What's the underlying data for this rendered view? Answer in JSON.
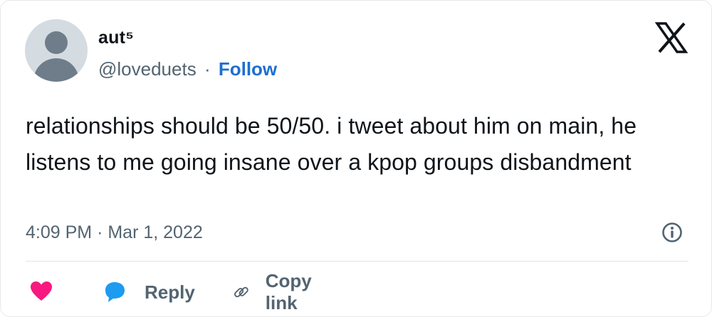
{
  "author": {
    "display_name": "aut⁵",
    "handle": "@loveduets",
    "separator": "·",
    "follow_label": "Follow",
    "avatar_icon": "default-avatar-icon"
  },
  "brand": {
    "logo_icon": "x-logo-icon",
    "follow_color": "#1d6fd1",
    "like_color": "#f91880",
    "reply_color": "#1d9bf0"
  },
  "tweet": {
    "text": "relationships should be 50/50. i tweet about him on main, he listens to me going insane over a kpop groups disbandment",
    "time": "4:09 PM",
    "date_separator": "·",
    "date": "Mar 1, 2022"
  },
  "actions": {
    "like_icon": "heart-icon",
    "reply_icon": "speech-bubble-icon",
    "reply_label": "Reply",
    "copy_icon": "link-icon",
    "copy_label": "Copy link",
    "info_icon": "info-icon"
  }
}
